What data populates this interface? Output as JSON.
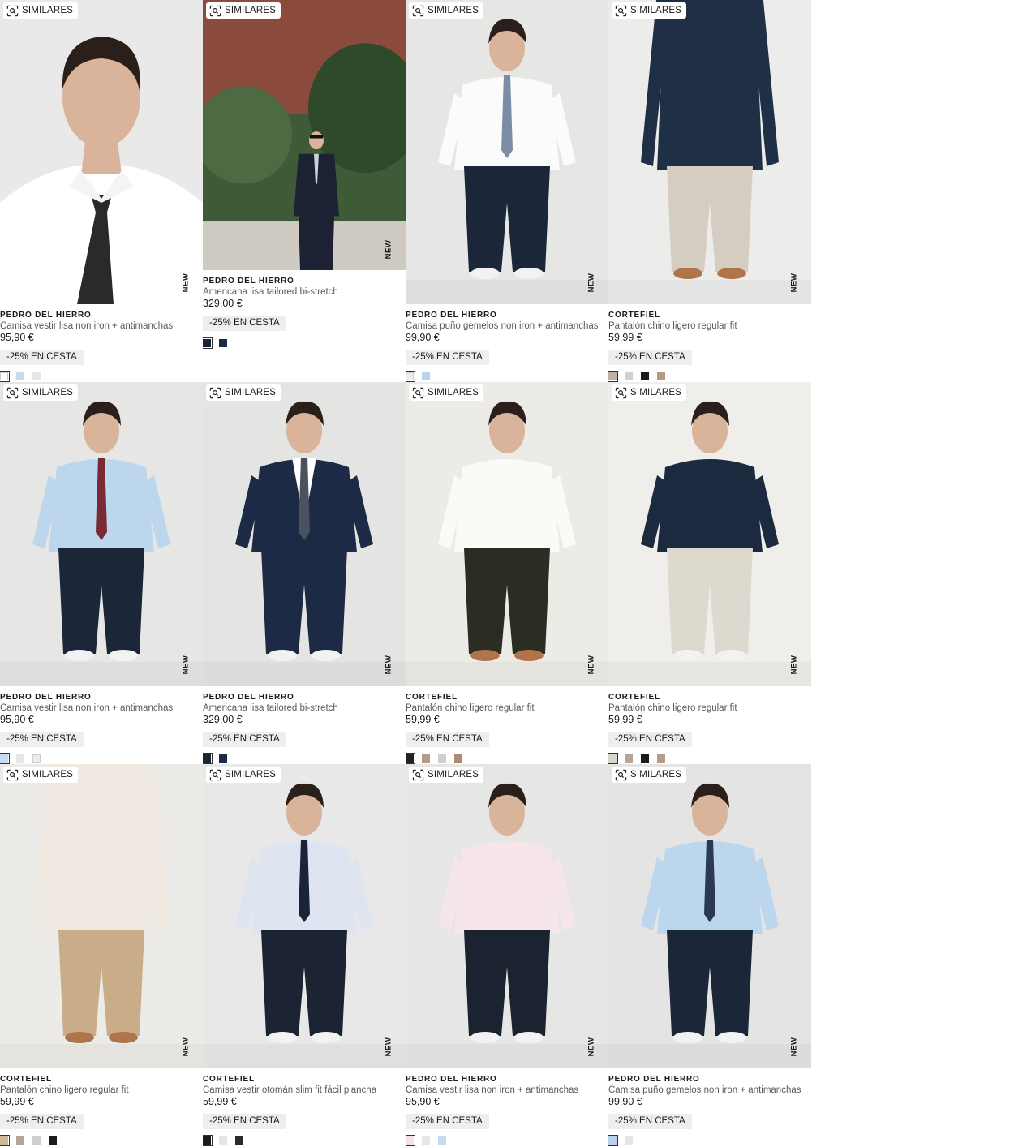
{
  "similares_label": "SIMILARES",
  "new_label": "NEW",
  "products": [
    {
      "brand": "PEDRO DEL HIERRO",
      "name": "Camisa vestir lisa non iron + antimanchas",
      "price": "95,90 €",
      "promo": "-25% EN CESTA",
      "bg": "#e9e9e9",
      "look": "portrait",
      "shirt": "#ffffff",
      "tie": "#2a2a2a",
      "pants": "#1d2a3d",
      "swatches": [
        "#ffffff",
        "#c6dcee",
        "#e6e6e6"
      ]
    },
    {
      "brand": "PEDRO DEL HIERRO",
      "name": "Americana lisa tailored bi-stretch",
      "price": "329,00 €",
      "promo": "-25% EN CESTA",
      "bg": "#6a7a5c",
      "look": "suit-outdoor",
      "shirt": "#ffffff",
      "tie": "#c9d2dc",
      "pants": "#1c2233",
      "swatches": [
        "#1a2433",
        "#1c2a46"
      ],
      "short": true
    },
    {
      "brand": "PEDRO DEL HIERRO",
      "name": "Camisa puño gemelos non iron + antimanchas",
      "price": "99,90 €",
      "promo": "-25% EN CESTA",
      "bg": "#e6e6e4",
      "look": "shirt-tie",
      "shirt": "#fbfbfb",
      "tie": "#7b8da6",
      "pants": "#1b2638",
      "swatches": [
        "#ececec",
        "#b9d1ea"
      ]
    },
    {
      "brand": "CORTEFIEL",
      "name": "Pantalón chino ligero regular fit",
      "price": "59,99 €",
      "promo": "-25% EN CESTA",
      "bg": "#ececeb",
      "look": "pants",
      "shirt": "#1f2f45",
      "tie": "",
      "pants": "#d6cdc2",
      "swatches": [
        "#bcb2a6",
        "#d3d1cd",
        "#1b1b1b",
        "#b59c84"
      ]
    },
    {
      "brand": "PEDRO DEL HIERRO",
      "name": "Camisa vestir lisa non iron + antimanchas",
      "price": "95,90 €",
      "promo": "-25% EN CESTA",
      "bg": "#e6e6e4",
      "look": "shirt-tie",
      "shirt": "#bcd6ee",
      "tie": "#7a2a35",
      "pants": "#1b2638",
      "swatches": [
        "#c6dcee",
        "#e6e6e6",
        "#ececec"
      ]
    },
    {
      "brand": "PEDRO DEL HIERRO",
      "name": "Americana lisa tailored bi-stretch",
      "price": "329,00 €",
      "promo": "-25% EN CESTA",
      "bg": "#e4e4e2",
      "look": "suit",
      "shirt": "#ffffff",
      "tie": "#4a5260",
      "pants": "#1c2a46",
      "swatches": [
        "#1a2433",
        "#1c2a46"
      ]
    },
    {
      "brand": "CORTEFIEL",
      "name": "Pantalón chino ligero regular fit",
      "price": "59,99 €",
      "promo": "-25% EN CESTA",
      "bg": "#ecebe6",
      "look": "casual",
      "shirt": "#fbfaf6",
      "tie": "",
      "pants": "#2b2c22",
      "swatches": [
        "#222222",
        "#b59c84",
        "#cfcfcf",
        "#b08a72"
      ]
    },
    {
      "brand": "CORTEFIEL",
      "name": "Pantalón chino ligero regular fit",
      "price": "59,99 €",
      "promo": "-25% EN CESTA",
      "bg": "#efeeea",
      "look": "polo",
      "shirt": "#1c2a3f",
      "tie": "",
      "pants": "#ddd9cf",
      "swatches": [
        "#d7d4cc",
        "#b3a697",
        "#1b1b1b",
        "#b59c84"
      ]
    },
    {
      "brand": "CORTEFIEL",
      "name": "Pantalón chino ligero regular fit",
      "price": "59,99 €",
      "promo": "-25% EN CESTA",
      "bg": "#ecebe8",
      "look": "pants",
      "shirt": "#efe9e2",
      "tie": "",
      "pants": "#c9ad88",
      "swatches": [
        "#d3b898",
        "#b3a697",
        "#cfcfcf",
        "#1b1b1b"
      ]
    },
    {
      "brand": "CORTEFIEL",
      "name": "Camisa vestir otomán slim fit fácil plancha",
      "price": "59,99 €",
      "promo": "-25% EN CESTA",
      "bg": "#e8e8e8",
      "look": "shirt-tie",
      "shirt": "#dfe5f0",
      "tie": "#1a2438",
      "pants": "#1c2433",
      "swatches": [
        "#1b1b1b",
        "#e6e6e6",
        "#2a2a2a"
      ]
    },
    {
      "brand": "PEDRO DEL HIERRO",
      "name": "Camisa vestir lisa non iron + antimanchas",
      "price": "95,90 €",
      "promo": "-25% EN CESTA",
      "bg": "#e6e6e4",
      "look": "shirt",
      "shirt": "#f6e6ea",
      "tie": "",
      "pants": "#1b2230",
      "swatches": [
        "#f4e3e7",
        "#e6e6e6",
        "#c6dcee"
      ]
    },
    {
      "brand": "PEDRO DEL HIERRO",
      "name": "Camisa puño gemelos non iron + antimanchas",
      "price": "99,90 €",
      "promo": "-25% EN CESTA",
      "bg": "#e3e4e3",
      "look": "shirt-tie",
      "shirt": "#bcd6ee",
      "tie": "#2a3a55",
      "pants": "#1b2638",
      "swatches": [
        "#b9d1ea",
        "#e6e6e6"
      ]
    }
  ]
}
